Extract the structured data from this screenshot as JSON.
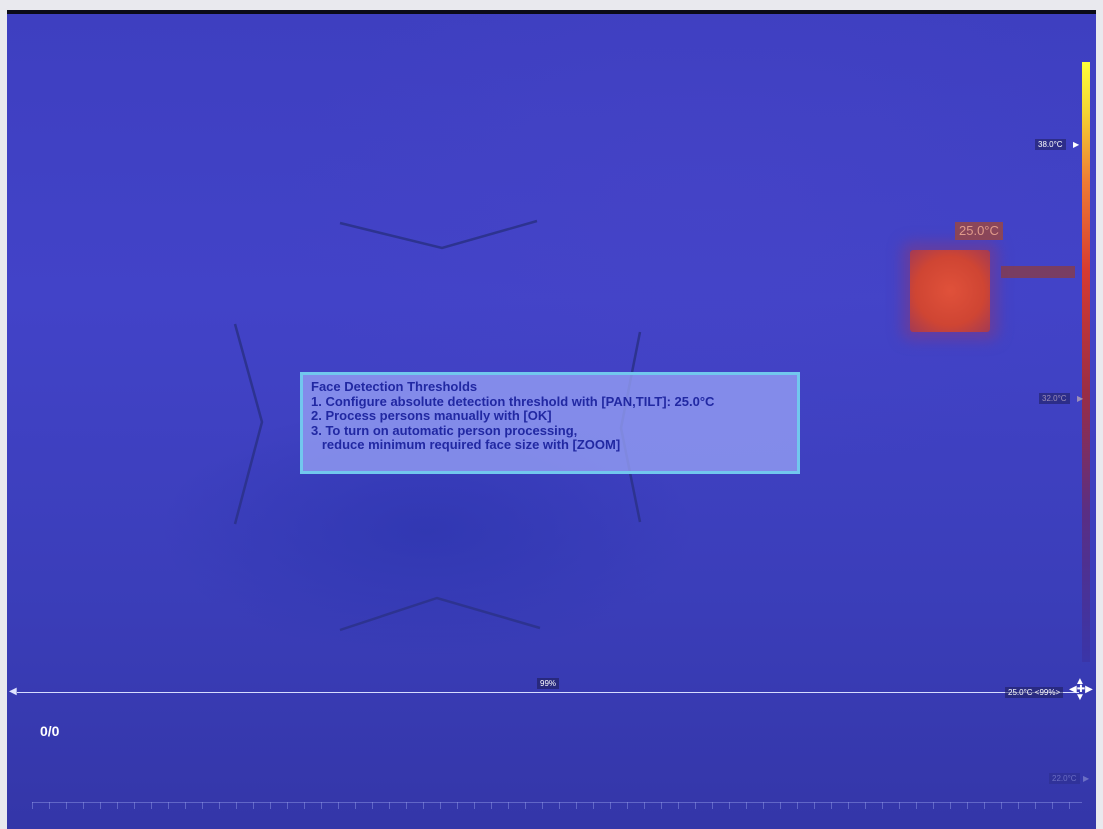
{
  "dialog": {
    "title": "Face Detection Thresholds",
    "line1": "1. Configure absolute detection threshold with [PAN,TILT]: 25.0°C",
    "line2": "2. Process persons manually with [OK]",
    "line3": "3. To turn on automatic person processing,",
    "line4": "   reduce minimum required face size with [ZOOM]"
  },
  "scale": {
    "top_label": "38.0°C",
    "top_marker": "▶",
    "mid_label": "32.0°C",
    "mid_marker": "▶",
    "bottom_label": "22.0°C",
    "bottom_marker": "▶"
  },
  "detection": {
    "object_temp": "25.0°C"
  },
  "threshold": {
    "percent": "99%",
    "label": "25.0°C <99%>",
    "left_arrow": "◀",
    "handle": "▲ ◀✚▶ ▼"
  },
  "counter": "0/0",
  "colors": {
    "background": "#3e3fc0",
    "dialog_border": "#72c7ee",
    "dialog_text": "#2128a2",
    "hot_object": "#d64a34",
    "scale_top": "#ffff3a"
  },
  "icons": [
    "face-guide-corners",
    "threshold-slider-handle-icon",
    "scale-pointer-icon"
  ]
}
